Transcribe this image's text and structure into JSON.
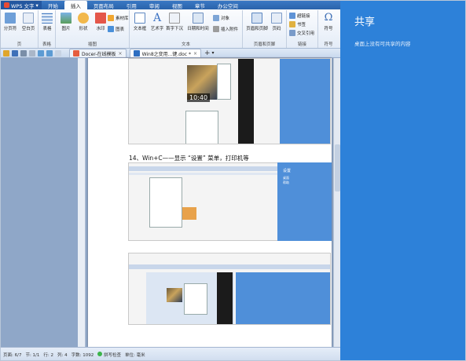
{
  "title_menu": "WPS 文字",
  "ribbon_tabs": [
    "开始",
    "插入",
    "页面布局",
    "引用",
    "审阅",
    "视图",
    "章节",
    "办公空间"
  ],
  "ribbon": {
    "groups": {
      "page": {
        "label": "页",
        "buttons": [
          "分页符",
          "空白页"
        ]
      },
      "table": {
        "label": "表格",
        "buttons": [
          "表格"
        ]
      },
      "illustrations": {
        "label": "插图",
        "buttons": [
          "图片",
          "形状",
          "水印"
        ],
        "small": [
          "素材库",
          "图表"
        ]
      },
      "text": {
        "label": "文本",
        "buttons": [
          "文本框",
          "艺术字",
          "首字下沉",
          "日期和时间"
        ],
        "small": [
          "对象",
          "插入附件"
        ]
      },
      "header": {
        "label": "页眉和页脚",
        "buttons": [
          "页眉和页脚",
          "页码"
        ]
      },
      "links": {
        "label": "链接",
        "small": [
          "超链接",
          "书签",
          "交叉引用"
        ]
      },
      "symbols": {
        "label": "符号",
        "buttons": [
          "符号"
        ]
      }
    }
  },
  "doc_tabs": [
    {
      "label": "Docer-在线模板",
      "active": false
    },
    {
      "label": "Win8之变用...键.doc *",
      "active": true
    }
  ],
  "document": {
    "heading": "14、Win+C——显示 “设置” 菜单，打印机等",
    "clock": "10:40",
    "settings_title": "设置",
    "settings_line1": "桌面",
    "settings_line2": "帮助"
  },
  "share_pane": {
    "title": "共享",
    "message": "桌面上没有可共享的内容"
  },
  "status": {
    "page": "页面: 6/7",
    "section": "节: 1/1",
    "line": "行: 2",
    "column": "列: 4",
    "words": "字数: 1092",
    "spell": "拼写检查",
    "unit": "单位: 毫米"
  },
  "colors": {
    "accent": "#2d81d9",
    "ribbon_blue": "#2a63ab",
    "status_ok": "#3bb44a"
  }
}
